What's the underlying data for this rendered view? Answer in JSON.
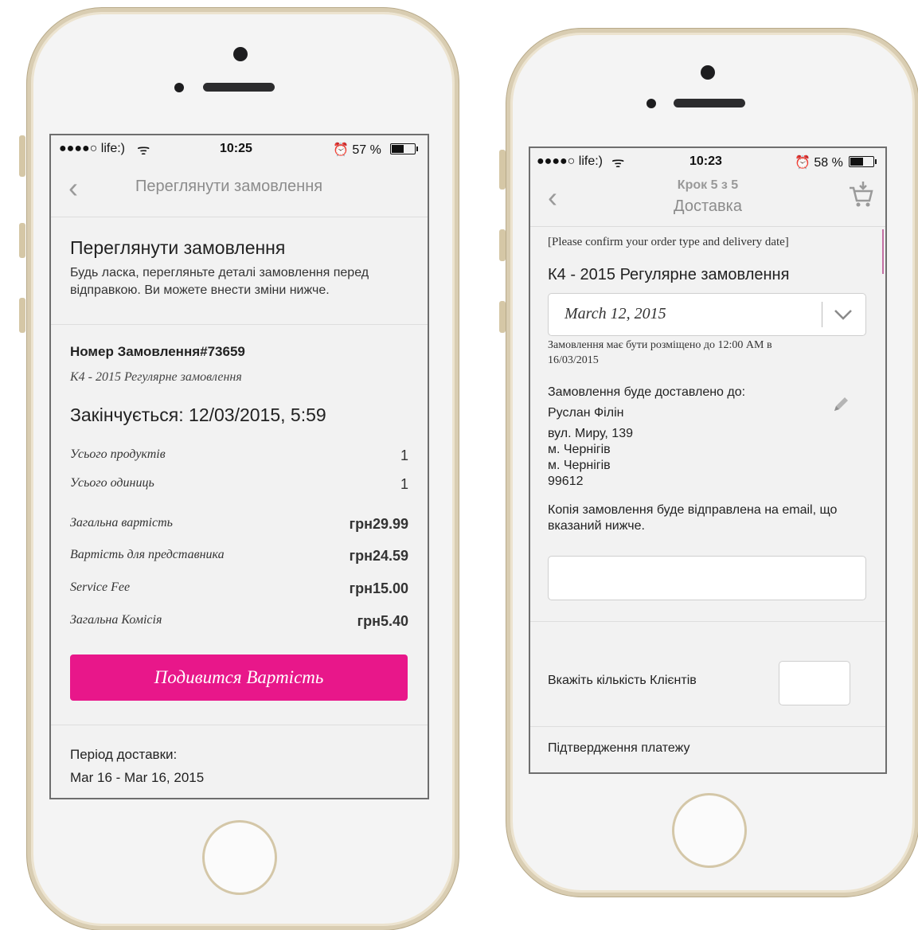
{
  "screen1": {
    "status": {
      "carrier": "●●●●○ life:)",
      "time": "10:25",
      "battery_text": "⏰ 57 %",
      "battery_level": 0.57
    },
    "nav": {
      "title": "Переглянути замовлення"
    },
    "intro": {
      "title": "Переглянути замовлення",
      "line1": "Будь ласка, перегляньте деталі замовлення перед",
      "line2": "відправкою. Ви можете внести зміни нижче."
    },
    "order": {
      "number": "Номер Замовлення#73659",
      "type": "К4 - 2015 Регулярне замовлення",
      "ends": "Закінчується: 12/03/2015, 5:59"
    },
    "rows": [
      {
        "label": "Усього продуктів",
        "value": "1"
      },
      {
        "label": "Усього одиниць",
        "value": "1"
      },
      {
        "label": "Загальна вартість",
        "value": "грн29.99"
      },
      {
        "label": "Вартість для представника",
        "value": "грн24.59"
      },
      {
        "label": "Service Fee",
        "value": "грн15.00"
      },
      {
        "label": "Загальна Комісія",
        "value": "грн5.40"
      }
    ],
    "cta_label": "Подивится Вартість",
    "delivery": {
      "label": "Період доставки:",
      "value": "Mar 16 - Mar 16, 2015"
    }
  },
  "screen2": {
    "status": {
      "carrier": "●●●●○ life:)",
      "time": "10:23",
      "battery_text": "⏰ 58 %",
      "battery_level": 0.58
    },
    "nav": {
      "step": "Крок 5 з 5",
      "title": "Доставка"
    },
    "confirm_note": "[Please confirm your order type and delivery date]",
    "order_type": "К4 - 2015 Регулярне замовлення",
    "date_value": "March 12, 2015",
    "deadline_line1": "Замовлення має бути розміщено до 12:00 AM в",
    "deadline_line2": "16/03/2015",
    "ship_label": "Замовлення буде доставлено до:",
    "address": [
      "Руслан Філін",
      "вул. Миру, 139",
      "м. Чернігів",
      "м. Чернігів",
      "99612"
    ],
    "email_note_line1": "Копія замовлення буде відправлена на email, що",
    "email_note_line2": "вказаний нижче.",
    "email_value": "",
    "clients_label": "Вкажіть кількість Клієнтів",
    "clients_value": "",
    "payment_label": "Підтвердження платежу"
  },
  "colors": {
    "accent": "#e8178a",
    "phone_frame": "#d9cdb2"
  },
  "icons": [
    "back-chevron-icon",
    "wifi-icon",
    "alarm-icon",
    "battery-icon",
    "chevron-down-icon",
    "pencil-icon",
    "cart-icon"
  ]
}
